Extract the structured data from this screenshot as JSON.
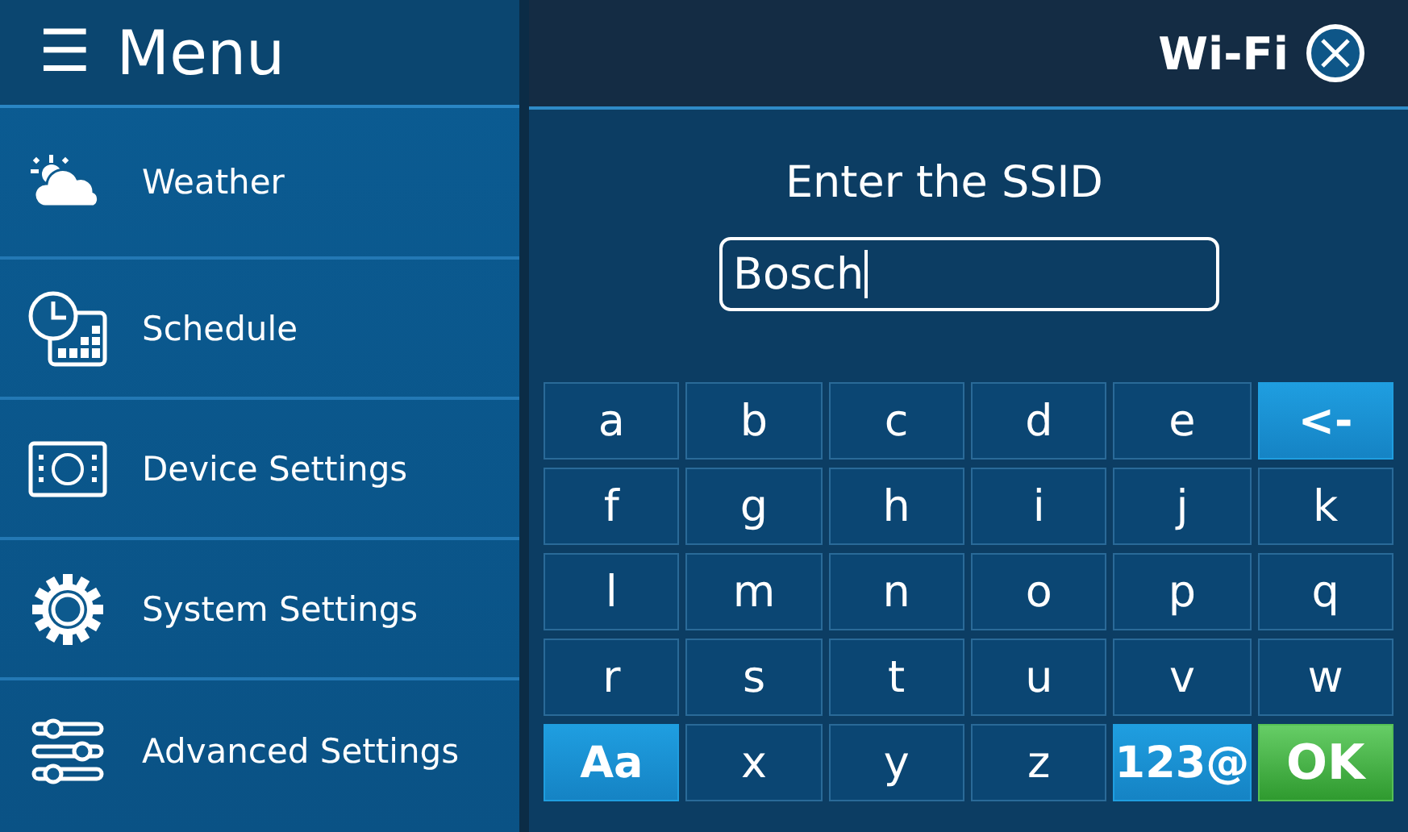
{
  "menu": {
    "icon": "☰",
    "title": "Menu",
    "items": [
      {
        "kind": "weather",
        "label": "Weather"
      },
      {
        "kind": "schedule",
        "label": "Schedule"
      },
      {
        "kind": "device",
        "label": "Device Settings"
      },
      {
        "kind": "gear",
        "label": "System Settings"
      },
      {
        "kind": "sliders",
        "label": "Advanced Settings"
      }
    ]
  },
  "header": {
    "title": "Wi-Fi"
  },
  "prompt": "Enter the SSID",
  "ssid_field": {
    "value": "Bosch"
  },
  "keys": [
    {
      "label": "a",
      "kind": "letter"
    },
    {
      "label": "b",
      "kind": "letter"
    },
    {
      "label": "c",
      "kind": "letter"
    },
    {
      "label": "d",
      "kind": "letter"
    },
    {
      "label": "e",
      "kind": "letter"
    },
    {
      "label": "<-",
      "kind": "action"
    },
    {
      "label": "f",
      "kind": "letter"
    },
    {
      "label": "g",
      "kind": "letter"
    },
    {
      "label": "h",
      "kind": "letter"
    },
    {
      "label": "i",
      "kind": "letter"
    },
    {
      "label": "j",
      "kind": "letter"
    },
    {
      "label": "k",
      "kind": "letter"
    },
    {
      "label": "l",
      "kind": "letter"
    },
    {
      "label": "m",
      "kind": "letter"
    },
    {
      "label": "n",
      "kind": "letter"
    },
    {
      "label": "o",
      "kind": "letter"
    },
    {
      "label": "p",
      "kind": "letter"
    },
    {
      "label": "q",
      "kind": "letter"
    },
    {
      "label": "r",
      "kind": "letter"
    },
    {
      "label": "s",
      "kind": "letter"
    },
    {
      "label": "t",
      "kind": "letter"
    },
    {
      "label": "u",
      "kind": "letter"
    },
    {
      "label": "v",
      "kind": "letter"
    },
    {
      "label": "w",
      "kind": "letter"
    },
    {
      "label": "Aa",
      "kind": "action"
    },
    {
      "label": "x",
      "kind": "letter"
    },
    {
      "label": "y",
      "kind": "letter"
    },
    {
      "label": "z",
      "kind": "letter"
    },
    {
      "label": "123@",
      "kind": "action"
    },
    {
      "label": "OK",
      "kind": "confirm"
    }
  ]
}
